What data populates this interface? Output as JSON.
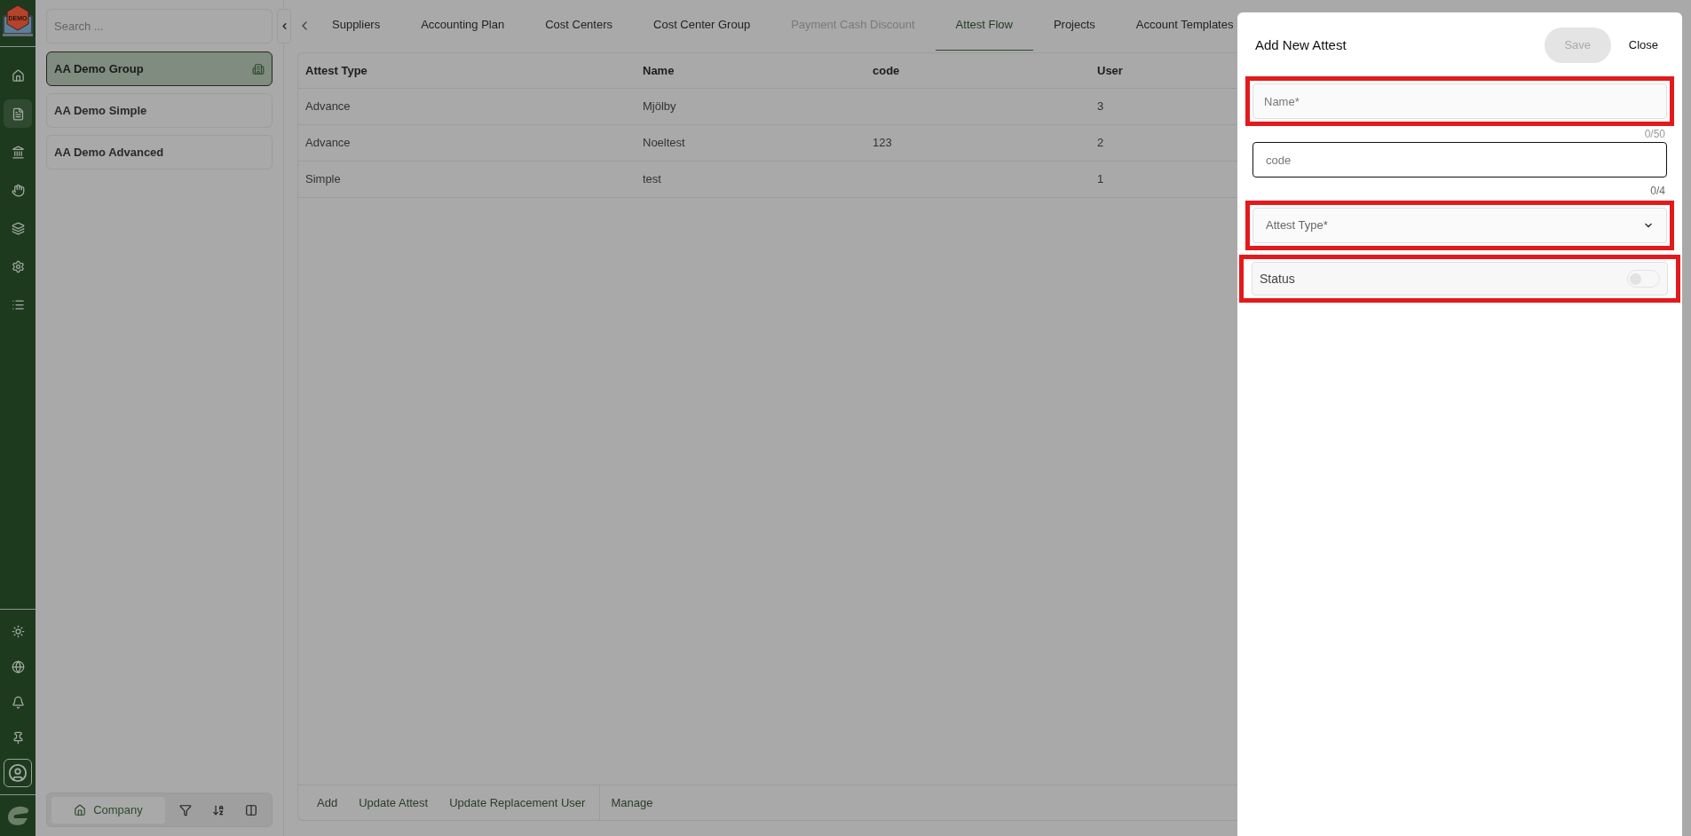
{
  "rail": {
    "logo_text": "DEMO",
    "items": [
      {
        "kind": "home",
        "selected": false
      },
      {
        "kind": "document",
        "selected": true
      },
      {
        "kind": "bank",
        "selected": false
      },
      {
        "kind": "hand",
        "selected": false
      },
      {
        "kind": "stack",
        "selected": false
      },
      {
        "kind": "settings",
        "selected": false
      },
      {
        "kind": "list",
        "selected": false
      }
    ],
    "bottom_items": [
      {
        "kind": "sun",
        "selected": false
      },
      {
        "kind": "globe",
        "selected": false
      },
      {
        "kind": "bell",
        "selected": false
      },
      {
        "kind": "pin",
        "selected": false
      },
      {
        "kind": "user",
        "selected": true
      }
    ]
  },
  "sidebar": {
    "search": {
      "placeholder": "Search ..."
    },
    "items": [
      {
        "label": "AA Demo Group",
        "selected": true
      },
      {
        "label": "AA Demo Simple",
        "selected": false
      },
      {
        "label": "AA Demo Advanced",
        "selected": false
      }
    ],
    "footer": {
      "company_button": "Company"
    }
  },
  "tabs": [
    {
      "label": "Suppliers",
      "selected": false,
      "disabled": false
    },
    {
      "label": "Accounting Plan",
      "selected": false,
      "disabled": false
    },
    {
      "label": "Cost Centers",
      "selected": false,
      "disabled": false
    },
    {
      "label": "Cost Center Group",
      "selected": false,
      "disabled": false
    },
    {
      "label": "Payment Cash Discount",
      "selected": false,
      "disabled": true
    },
    {
      "label": "Attest Flow",
      "selected": true,
      "disabled": false
    },
    {
      "label": "Projects",
      "selected": false,
      "disabled": false
    },
    {
      "label": "Account Templates",
      "selected": false,
      "disabled": false
    }
  ],
  "table": {
    "columns": [
      "Attest Type",
      "Name",
      "code",
      "User"
    ],
    "rows": [
      [
        "Advance",
        "Mjölby",
        "",
        "3"
      ],
      [
        "Advance",
        "Noeltest",
        "123",
        "2"
      ],
      [
        "Simple",
        "test",
        "",
        "1"
      ]
    ]
  },
  "actions": [
    "Add",
    "Update Attest",
    "Update Replacement User",
    "Manage"
  ],
  "drawer": {
    "title": "Add New Attest",
    "save_button": "Save",
    "close_button": "Close",
    "name_field": {
      "placeholder": "Name*",
      "counter": "0/50"
    },
    "code_field": {
      "placeholder": "code",
      "counter": "0/4"
    },
    "type_select": {
      "placeholder": "Attest Type*"
    },
    "status": {
      "label": "Status",
      "on": false
    }
  }
}
